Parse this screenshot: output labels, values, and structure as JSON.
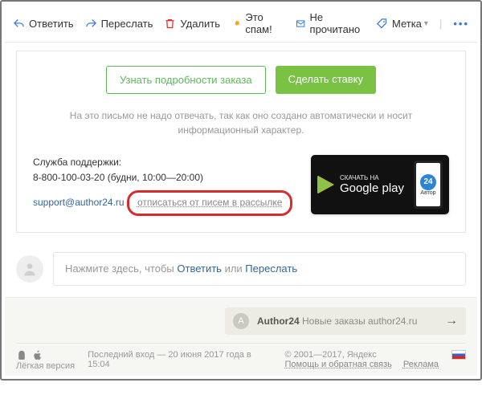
{
  "toolbar": {
    "reply": "Ответить",
    "forward": "Переслать",
    "delete": "Удалить",
    "spam": "Это спам!",
    "unread": "Не прочитано",
    "label": "Метка"
  },
  "email": {
    "btn_details": "Узнать подробности заказа",
    "btn_bid": "Сделать ставку",
    "auto_note": "На это письмо не надо отвечать, так как оно создано автоматически и носит информационный характер.",
    "support_title": "Служба поддержки:",
    "support_phone": "8-800-100-03-20 (будни, 10:00—20:00)",
    "support_email": "support@author24.ru",
    "unsubscribe": "отписаться от писем в рассылке",
    "gp_small": "СКАЧАТЬ НА",
    "gp_big": "Google play",
    "gp_phone_label": "24",
    "gp_phone_brand": "Автор"
  },
  "reply": {
    "prefix": "Нажмите здесь, чтобы ",
    "reply_link": "Ответить",
    "mid": " или ",
    "forward_link": "Переслать"
  },
  "notification": {
    "badge": "A",
    "title": "Author24",
    "text": "Новые заказы author24.ru"
  },
  "footer": {
    "light_version": "Лёгкая версия",
    "last_login": "Последний вход — 20 июня 2017 года в 15:04",
    "copyright": "© 2001—2017, Яндекс",
    "help": "Помощь и обратная связь",
    "ads": "Реклама"
  }
}
